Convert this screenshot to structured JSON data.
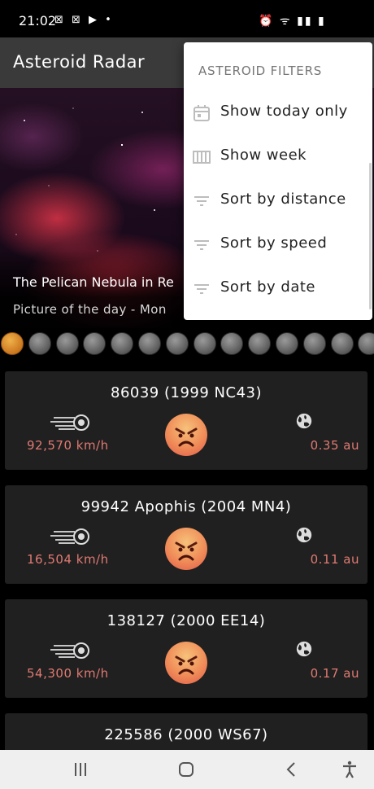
{
  "status_bar": {
    "time": "21:02",
    "left_icons": "⊠ ⊠ ▶ •",
    "right_icons": "⏰ ᯤ ▮▮ ▮"
  },
  "toolbar": {
    "title": "Asteroid Radar",
    "overflow_icon": "more-vert-icon"
  },
  "picture_of_day": {
    "title": "The Pelican Nebula in Re",
    "caption": "Picture of the day - Mon"
  },
  "date_selector": {
    "count": 14,
    "selected_index": 0,
    "selected_color": "#e29a3a",
    "default_color": "#7a7a7a"
  },
  "asteroids": [
    {
      "name": "86039 (1999 NC43)",
      "speed": "92,570 km/h",
      "distance": "0.35 au",
      "hazardous": true
    },
    {
      "name": "99942 Apophis (2004 MN4)",
      "speed": "16,504 km/h",
      "distance": "0.11 au",
      "hazardous": true
    },
    {
      "name": "138127 (2000 EE14)",
      "speed": "54,300 km/h",
      "distance": "0.17 au",
      "hazardous": true
    },
    {
      "name": "225586 (2000 WS67)",
      "speed": "",
      "distance": "",
      "hazardous": true
    }
  ],
  "filter_menu": {
    "header": "ASTEROID FILTERS",
    "items": [
      {
        "label": "Show today only",
        "icon": "calendar-today-icon"
      },
      {
        "label": "Show week",
        "icon": "view-week-icon"
      },
      {
        "label": "Sort by distance",
        "icon": "sort-icon"
      },
      {
        "label": "Sort by speed",
        "icon": "sort-icon"
      },
      {
        "label": "Sort by date",
        "icon": "sort-icon"
      }
    ]
  },
  "colors": {
    "toolbar": "#3a3a3a",
    "card": "#202020",
    "accent_text": "#e07a72",
    "menu_icon": "#bdbdbd"
  },
  "nav_bar": {
    "recents_icon": "recents-icon",
    "home_icon": "home-icon",
    "back_icon": "back-icon",
    "accessibility_icon": "accessibility-icon"
  }
}
